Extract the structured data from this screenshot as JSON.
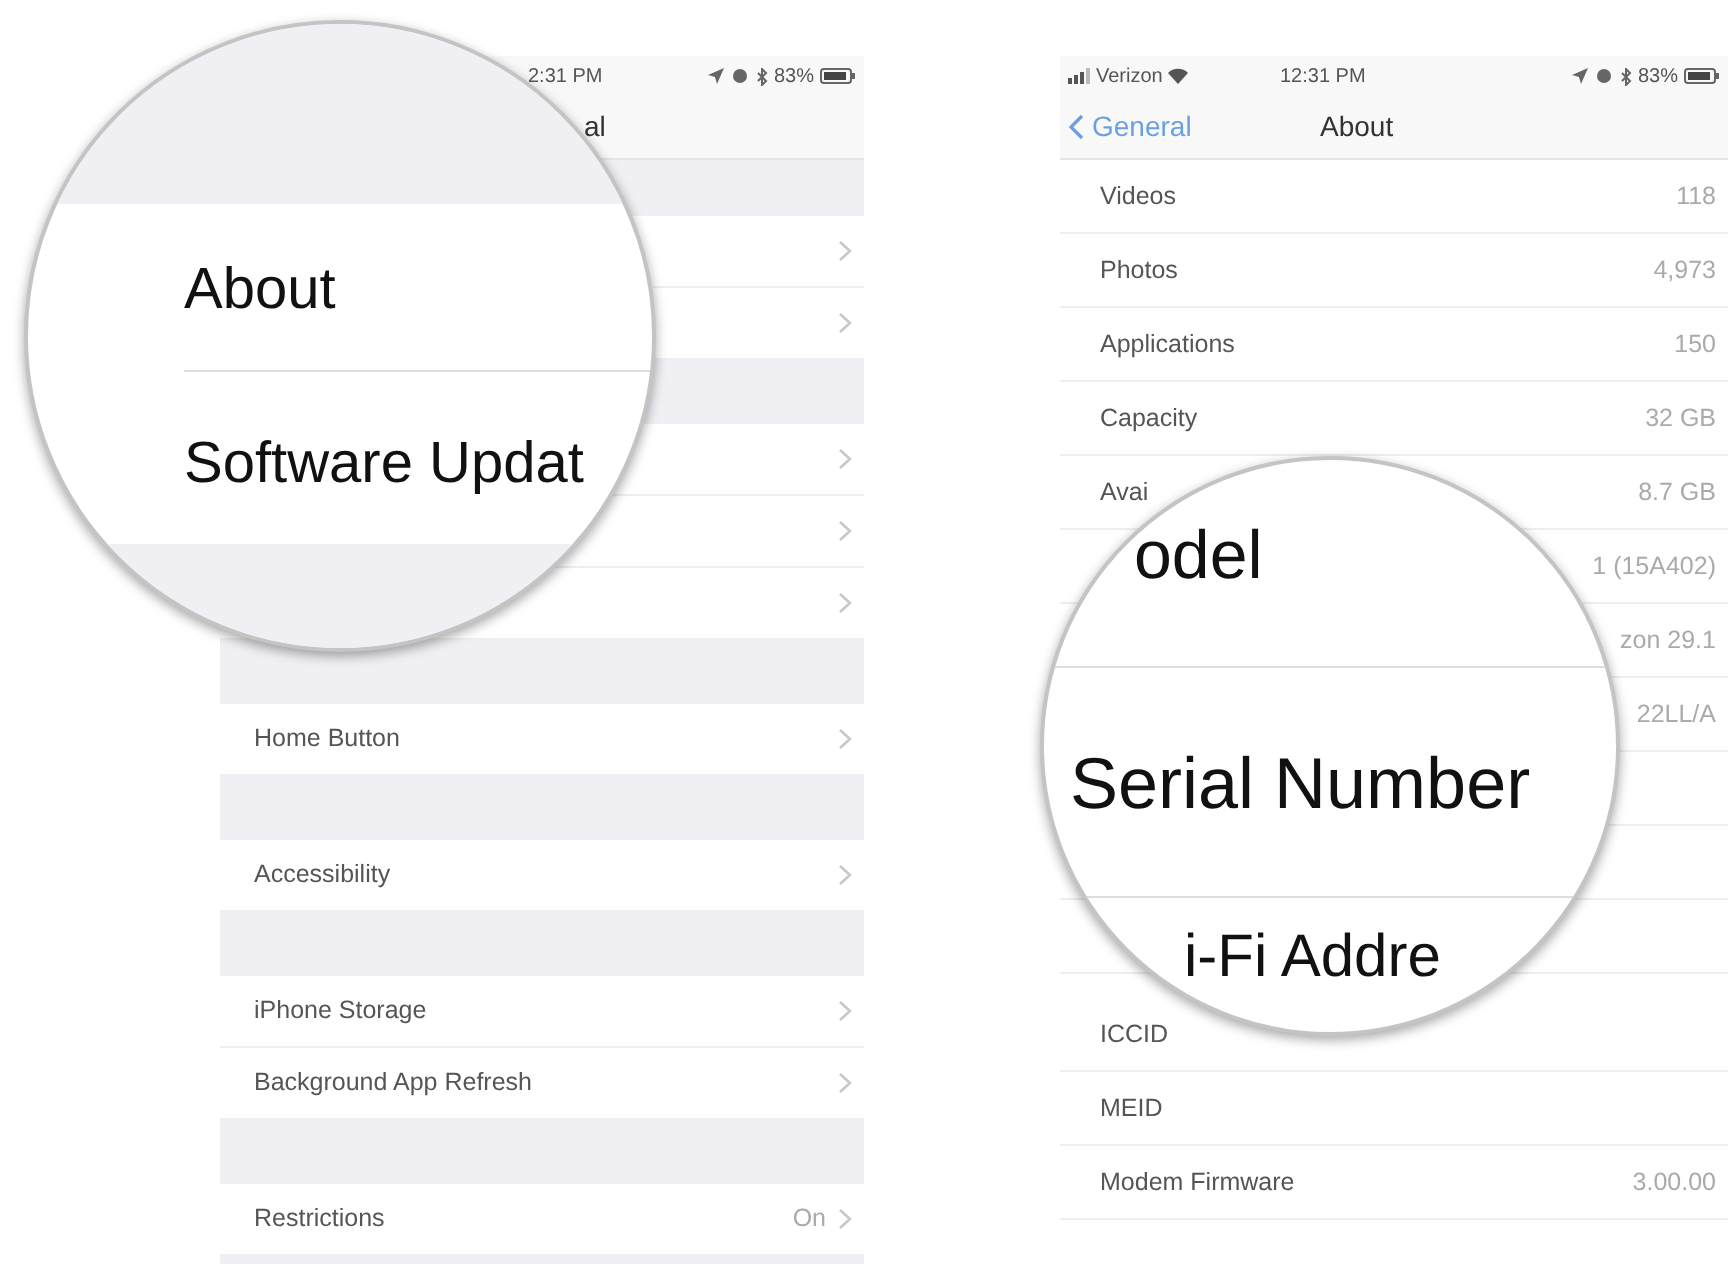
{
  "left_screen": {
    "status_bar": {
      "time": "2:31 PM",
      "battery": "83%"
    },
    "nav_title": "al",
    "groups": [
      {
        "rows": [
          {
            "chevron": true
          },
          {
            "chevron": true
          }
        ]
      },
      {
        "rows": [
          {
            "chevron": true
          },
          {
            "chevron": true
          },
          {
            "chevron": true
          }
        ]
      },
      {
        "rows": [
          {
            "label": "Home Button",
            "chevron": true
          }
        ]
      },
      {
        "rows": [
          {
            "label": "Accessibility",
            "chevron": true
          }
        ]
      },
      {
        "rows": [
          {
            "label": "iPhone Storage",
            "chevron": true
          },
          {
            "label": "Background App Refresh",
            "chevron": true
          }
        ]
      },
      {
        "rows": [
          {
            "label": "Restrictions",
            "value": "On",
            "chevron": true
          }
        ]
      }
    ],
    "magnifier": {
      "rows": [
        {
          "label": "About"
        },
        {
          "label": "Software Updat"
        }
      ]
    }
  },
  "right_screen": {
    "status_bar": {
      "carrier": "Verizon",
      "time": "12:31 PM",
      "battery": "83%"
    },
    "nav": {
      "back": "General",
      "title": "About"
    },
    "groups": [
      {
        "rows": [
          {
            "label": "Videos",
            "value": "118"
          },
          {
            "label": "Photos",
            "value": "4,973"
          },
          {
            "label": "Applications",
            "value": "150"
          },
          {
            "label": "Capacity",
            "value": "32 GB"
          },
          {
            "label": "Avai",
            "value": "8.7 GB"
          },
          {
            "value": "1 (15A402)"
          },
          {
            "value": "zon 29.1"
          },
          {
            "value": "22LL/A"
          },
          {},
          {},
          {}
        ]
      },
      {
        "rows": [
          {
            "label": "ICCID"
          },
          {
            "label": "MEID"
          },
          {
            "label": "Modem Firmware",
            "value": "3.00.00"
          }
        ]
      }
    ],
    "magnifier": {
      "rows": [
        {
          "label": "odel"
        },
        {
          "label": "Serial Number"
        },
        {
          "label": "i-Fi Addre"
        }
      ]
    }
  }
}
